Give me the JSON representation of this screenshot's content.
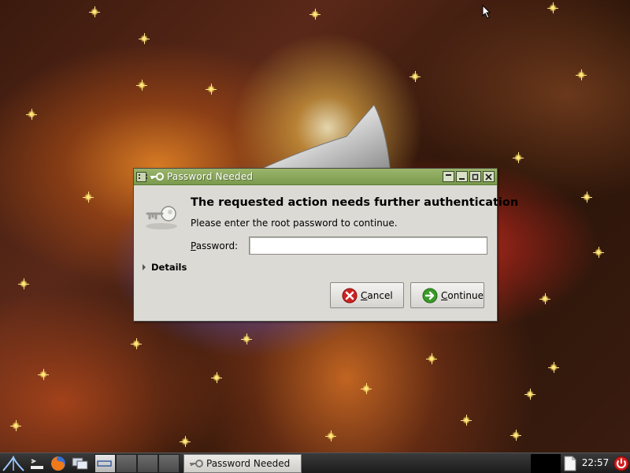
{
  "dialog": {
    "window_title": "Password Needed",
    "headline": "The requested action needs further authentication",
    "message": "Please enter the root password to continue.",
    "password_label_mnemonic": "P",
    "password_label_rest": "assword:",
    "password_value": "",
    "details_label": "Details",
    "cancel_mnemonic": "C",
    "cancel_rest": "ancel",
    "continue_mnemonic": "C",
    "continue_rest": "ontinue",
    "titlebar_buttons": [
      "shade-icon",
      "minimize-icon",
      "maximize-icon",
      "close-icon"
    ]
  },
  "taskbar": {
    "task_label": "Password Needed",
    "clock": "22:57",
    "launchers": [
      "start-menu-icon",
      "terminal-icon",
      "firefox-icon",
      "show-windows-icon"
    ],
    "workspaces": 4,
    "active_workspace": 1
  },
  "colors": {
    "titlebar": "#8aa85c",
    "dialog_bg": "#dcdad5",
    "taskbar": "#2a2a2a",
    "cancel_icon": "#cc2222",
    "continue_icon": "#3a9a2a"
  }
}
